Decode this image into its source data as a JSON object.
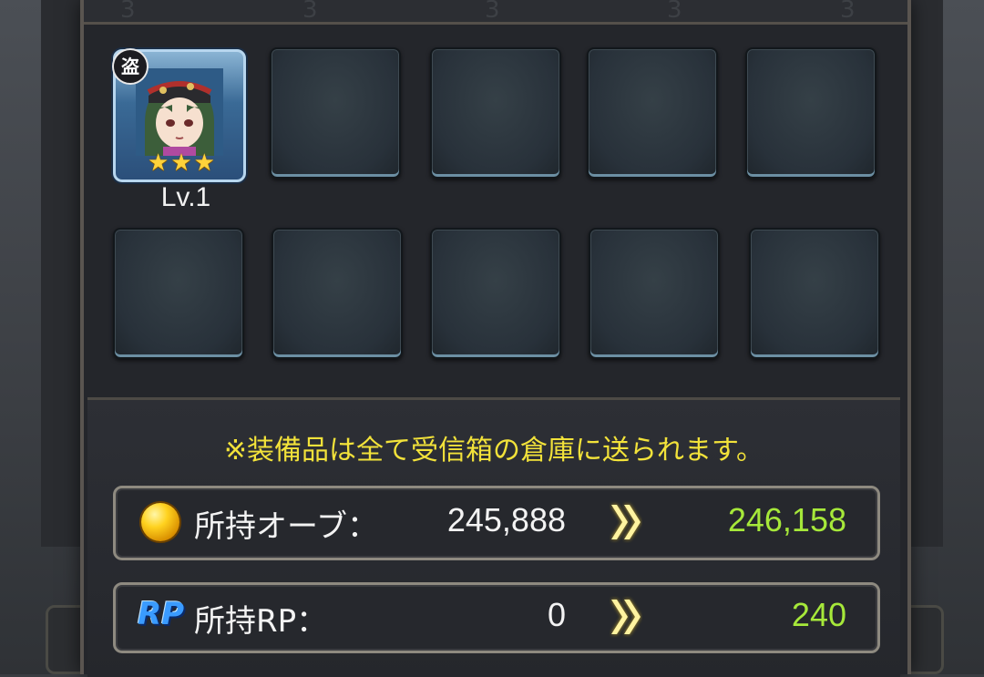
{
  "background": {
    "top_strip_digits": [
      "3",
      "3",
      "3",
      "3",
      "3"
    ]
  },
  "hero": {
    "class_badge": "盗",
    "stars": [
      "★",
      "★",
      "★"
    ],
    "level": "Lv.1"
  },
  "notice": "※装備品は全て受信箱の倉庫に送られます。",
  "orb": {
    "label": "所持オーブ：",
    "current": "245,888",
    "after": "246,158"
  },
  "rp": {
    "icon_text": "RP",
    "label": "所持RP：",
    "current": "0",
    "after": "240"
  },
  "colors": {
    "notice": "#f2e23a",
    "gain_value": "#a6e83a",
    "arrow": "#ffd42a"
  },
  "icons": [
    "orb-icon",
    "rp-icon",
    "double-chevron-right-icon",
    "thief-class-icon",
    "star-icon"
  ],
  "empty_slot_count": 9
}
